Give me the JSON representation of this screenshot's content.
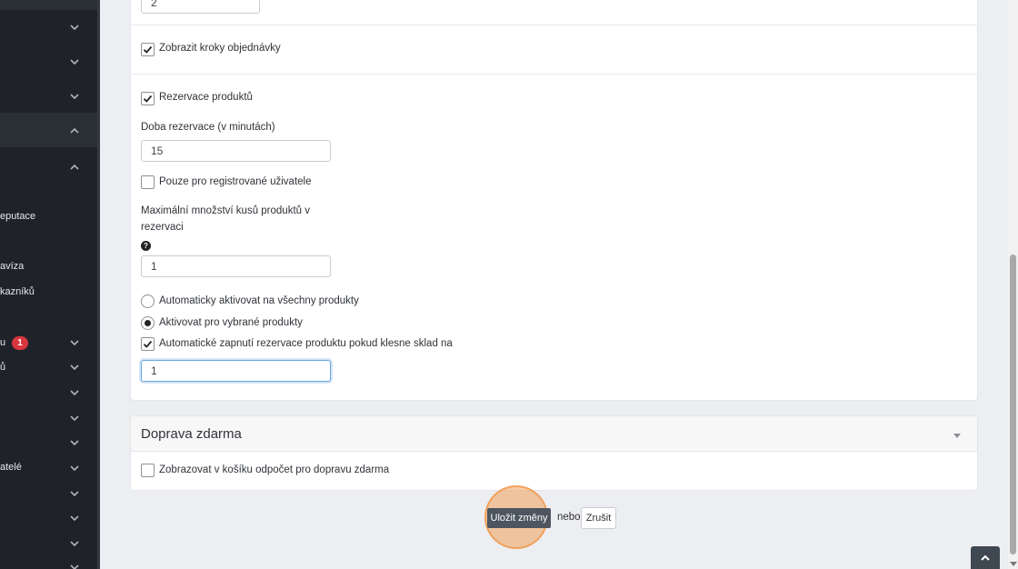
{
  "sidebar": {
    "items": [
      {
        "label": "",
        "badge": ""
      },
      {
        "label": "",
        "badge": ""
      },
      {
        "label": "",
        "badge": ""
      },
      {
        "label": "",
        "badge": ""
      },
      {
        "label": "",
        "badge": ""
      },
      {
        "label": "eputace",
        "badge": ""
      },
      {
        "label": "avíza",
        "badge": ""
      },
      {
        "label": "kazníků",
        "badge": ""
      },
      {
        "label": "u",
        "badge": "1"
      },
      {
        "label": "ů",
        "badge": ""
      },
      {
        "label": "",
        "badge": ""
      },
      {
        "label": "",
        "badge": ""
      },
      {
        "label": "",
        "badge": ""
      },
      {
        "label": "atelé",
        "badge": ""
      },
      {
        "label": "",
        "badge": ""
      },
      {
        "label": "",
        "badge": ""
      },
      {
        "label": "",
        "badge": ""
      },
      {
        "label": "",
        "badge": ""
      }
    ]
  },
  "form": {
    "top_input_value": "2",
    "show_order_steps": {
      "label": "Zobrazit kroky objednávky",
      "checked": true
    },
    "product_reservation": {
      "label": "Rezervace produktů",
      "checked": true
    },
    "reservation_time_label": "Doba rezervace (v minutách)",
    "reservation_time_value": "15",
    "registered_only": {
      "label": "Pouze pro registrované uživatele",
      "checked": false
    },
    "max_qty_label_line1": "Maximální množství kusů produktů v",
    "max_qty_label_line2": "rezervaci",
    "max_qty_value": "1",
    "radio_all": {
      "label": "Automaticky aktivovat na všechny produkty",
      "selected": false
    },
    "radio_selected": {
      "label": "Aktivovat pro vybrané produkty",
      "selected": true
    },
    "auto_reservation": {
      "label": "Automatické zapnutí rezervace produktu pokud klesne sklad na",
      "checked": true
    },
    "auto_reservation_value": "1"
  },
  "free_shipping": {
    "title": "Doprava zdarma",
    "show_countdown": {
      "label": "Zobrazovat v košíku odpočet pro dopravu zdarma",
      "checked": false
    }
  },
  "actions": {
    "save_label": "Uložit změny",
    "or_label": "nebo",
    "cancel_label": "Zrušit"
  },
  "colors": {
    "sidebar_bg": "#1f2329",
    "badge": "#d9363e",
    "save_button": "#4d5660",
    "click_highlight": "#f0a05a"
  }
}
